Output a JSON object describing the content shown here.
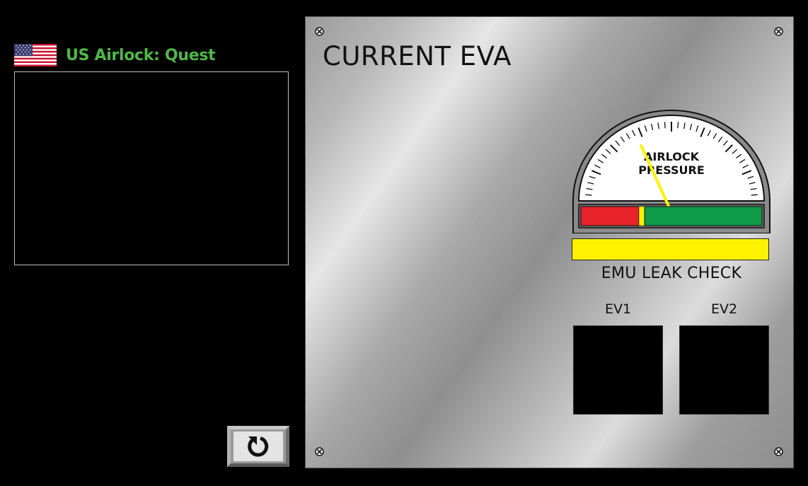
{
  "airlock": {
    "title": "US Airlock: Quest",
    "flag_icon": "us-flag-icon"
  },
  "refresh_button": {
    "icon": "refresh-icon"
  },
  "panel": {
    "title": "CURRENT EVA",
    "gauge": {
      "label_line1": "AIRLOCK",
      "label_line2": "PRESSURE",
      "needle_level": 0.28,
      "band_colors": {
        "low": "#e8242a",
        "mid": "#fff200",
        "high": "#0f9a49"
      }
    },
    "leak_check": {
      "label": "EMU LEAK CHECK",
      "indicator_color": "#fff200"
    },
    "ev1": {
      "label": "EV1"
    },
    "ev2": {
      "label": "EV2"
    }
  },
  "colors": {
    "background": "#000000",
    "accent_green": "#4fb848",
    "needle": "#fff200"
  }
}
